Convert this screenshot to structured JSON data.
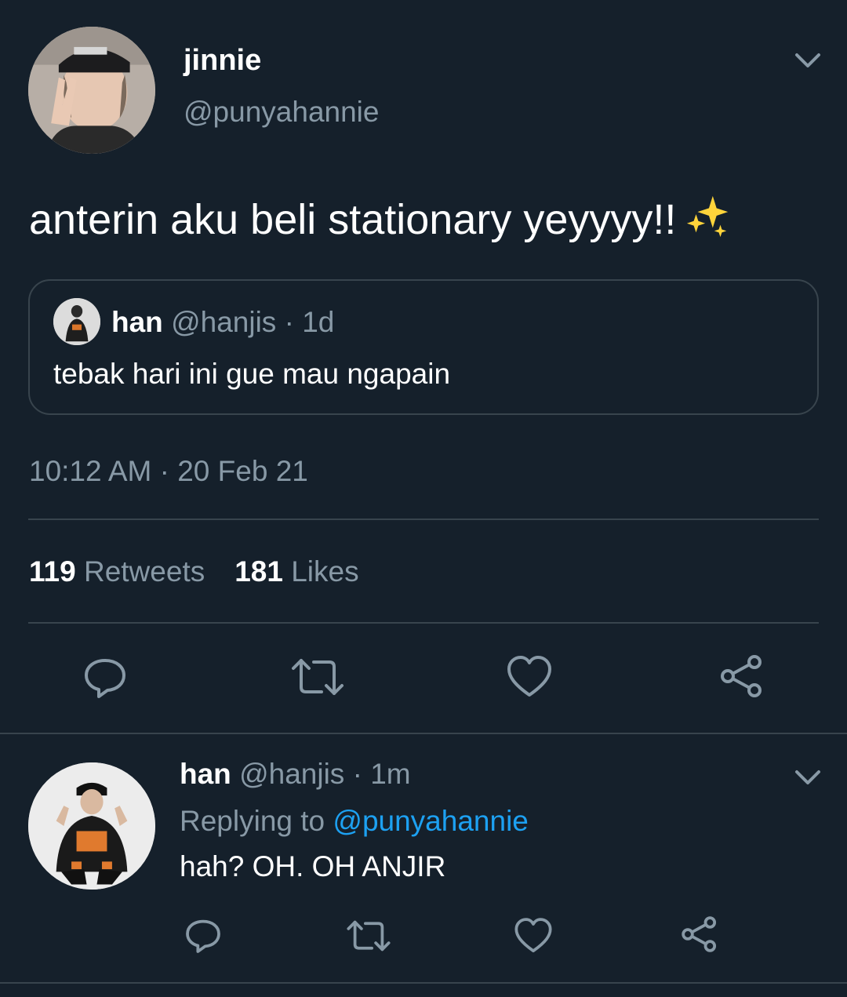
{
  "main_tweet": {
    "author_name": "jinnie",
    "author_handle": "@punyahannie",
    "text": "anterin aku beli stationary yeyyyy!!",
    "emoji": "sparkles-icon",
    "quoted": {
      "author_name": "han",
      "author_handle": "@hanjis",
      "separator": "·",
      "age": "1d",
      "text": "tebak hari ini gue mau ngapain"
    },
    "time": "10:12 AM",
    "separator": "·",
    "date": "20 Feb 21",
    "retweets_count": "119",
    "retweets_label": "Retweets",
    "likes_count": "181",
    "likes_label": "Likes"
  },
  "reply": {
    "author_name": "han",
    "author_handle": "@hanjis",
    "separator": "·",
    "age": "1m",
    "replying_label": "Replying to",
    "replying_handle": "@punyahannie",
    "text": "hah? OH. OH ANJIR"
  },
  "actions": [
    "reply-icon",
    "retweet-icon",
    "like-icon",
    "share-icon"
  ],
  "colors": {
    "background": "#15202b",
    "divider": "#38444d",
    "secondary_text": "#8899a6",
    "link": "#1da1f2",
    "primary_text": "#ffffff"
  }
}
